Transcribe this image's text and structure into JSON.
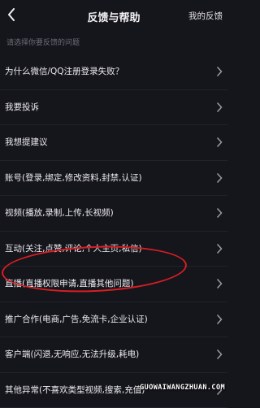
{
  "header": {
    "title": "反馈与帮助",
    "right_link": "我的反馈",
    "back_icon": "chevron-left-icon"
  },
  "section": {
    "label": "请选择你要反馈的问题"
  },
  "items": [
    {
      "label": "为什么微信/QQ注册登录失败？"
    },
    {
      "label": "我要投诉"
    },
    {
      "label": "我想提建议"
    },
    {
      "label": "账号(登录,绑定,修改资料,封禁,认证)"
    },
    {
      "label": "视频(播放,录制,上传,长视频)"
    },
    {
      "label": "互动(关注,点赞,评论,个人主页,私信)"
    },
    {
      "label": "直播(直播权限申请,直播其他问题)"
    },
    {
      "label": "推广合作(电商,广告,免流卡,企业认证)"
    },
    {
      "label": "客户端(闪退,无响应,无法升级,耗电)"
    },
    {
      "label": "其他异常(不喜欢类型视频,搜索,充值)"
    }
  ],
  "annotation": {
    "color": "#d81e22",
    "target_item_index": 6
  },
  "watermark": {
    "text": "GUOWAIWANGZHUAN.COM"
  },
  "colors": {
    "background": "#15151c",
    "text": "#ececf0",
    "muted": "#6e6e78"
  }
}
